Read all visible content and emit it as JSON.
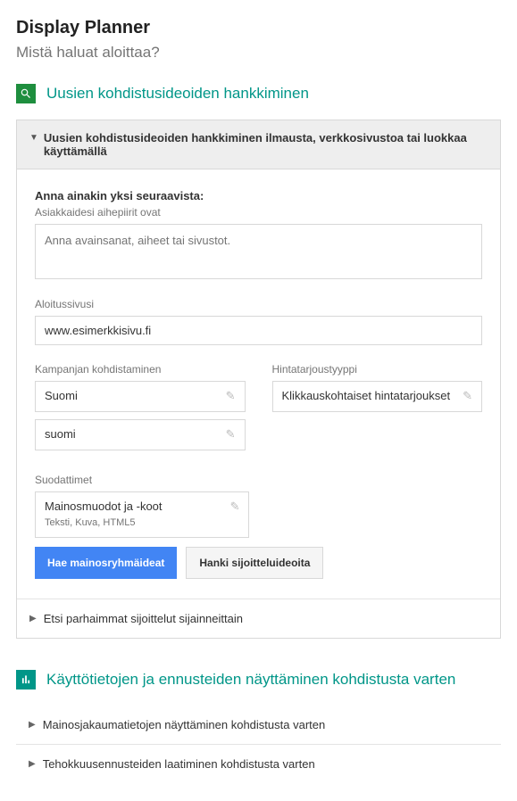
{
  "page": {
    "title": "Display Planner",
    "subtitle": "Mistä haluat aloittaa?"
  },
  "section1": {
    "title": "Uusien kohdistusideoiden hankkiminen",
    "panel_header": "Uusien kohdistusideoiden hankkiminen ilmausta, verkkosivustoa tai luokkaa käyttämällä",
    "instruction": "Anna ainakin yksi seuraavista:",
    "topics_label": "Asiakkaidesi aihepiirit ovat",
    "topics_placeholder": "Anna avainsanat, aiheet tai sivustot.",
    "landing_label": "Aloitussivusi",
    "landing_value": "www.esimerkkisivu.fi",
    "targeting_label": "Kampanjan kohdistaminen",
    "targeting_country": "Suomi",
    "targeting_lang": "suomi",
    "bid_label": "Hintatarjoustyyppi",
    "bid_value": "Klikkauskohtaiset hintatarjoukset",
    "filters_label": "Suodattimet",
    "filters_title": "Mainosmuodot ja -koot",
    "filters_sub": "Teksti, Kuva, HTML5",
    "btn_primary": "Hae mainosryhmäideat",
    "btn_secondary": "Hanki sijoitteluideoita",
    "expand_placements": "Etsi parhaimmat sijoittelut sijainneittain"
  },
  "section2": {
    "title": "Käyttötietojen ja ennusteiden näyttäminen kohdistusta varten",
    "expand_inventory": "Mainosjakaumatietojen näyttäminen kohdistusta varten",
    "expand_performance": "Tehokkuusennusteiden laatiminen kohdistusta varten"
  }
}
